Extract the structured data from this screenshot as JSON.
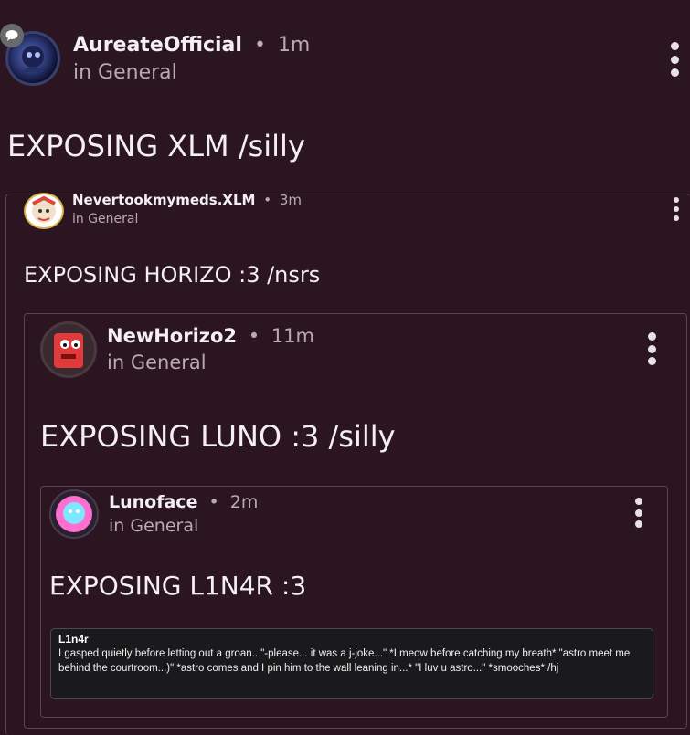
{
  "posts": [
    {
      "username": "AureateOfficial",
      "separator": "•",
      "time": "1m",
      "channel": "in General",
      "title": "EXPOSING XLM /silly"
    },
    {
      "username": "Nevertookmymeds.XLM",
      "separator": "•",
      "time": "3m",
      "channel": "in General",
      "title": "EXPOSING HORIZO :3 /nsrs"
    },
    {
      "username": "NewHorizo2",
      "separator": "•",
      "time": "11m",
      "channel": "in General",
      "title": "EXPOSING LUNO :3 /silly"
    },
    {
      "username": "Lunoface",
      "separator": "•",
      "time": "2m",
      "channel": "in General",
      "title": "EXPOSING L1N4R :3"
    }
  ],
  "quote": {
    "name": "L1n4r",
    "text": "I gasped quietly before letting out a groan.. \"-please... it was a j-joke...\" *I meow before catching my breath* \"astro meet me behind the courtroom...)\" *astro comes and I pin him to the wall leaning in...* \"I luv u astro...\" *smooches* /hj"
  },
  "colors": {
    "background": "#2b1521",
    "card_border": "#5a4450",
    "muted_text": "#b8aab2"
  }
}
